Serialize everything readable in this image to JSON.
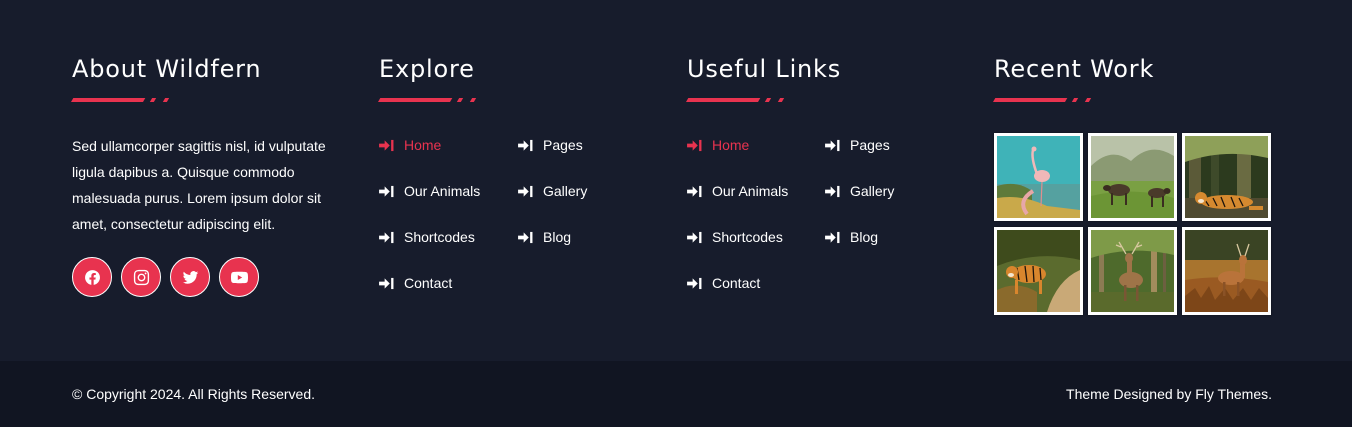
{
  "about": {
    "title": "About Wildfern",
    "text": "Sed ullamcorper sagittis nisl, id vulputate ligula dapibus a. Quisque commodo malesuada purus. Lorem ipsum dolor sit amet, consectetur adipiscing elit.",
    "socials": [
      {
        "name": "facebook-icon"
      },
      {
        "name": "instagram-icon"
      },
      {
        "name": "twitter-icon"
      },
      {
        "name": "youtube-icon"
      }
    ]
  },
  "explore": {
    "title": "Explore",
    "items": [
      "Home",
      "Pages",
      "Our Animals",
      "Gallery",
      "Shortcodes",
      "Blog",
      "Contact"
    ]
  },
  "useful": {
    "title": "Useful Links",
    "items": [
      "Home",
      "Pages",
      "Our Animals",
      "Gallery",
      "Shortcodes",
      "Blog",
      "Contact"
    ]
  },
  "recent": {
    "title": "Recent Work",
    "images": [
      "flamingo",
      "wildebeest",
      "tiger-resting",
      "tiger-walking",
      "deer-forest",
      "deer-field"
    ]
  },
  "footer": {
    "copyright": "© Copyright 2024. All Rights Reserved.",
    "credit_prefix": "Theme Designed by ",
    "credit_link": "Fly Themes",
    "credit_suffix": "."
  },
  "colors": {
    "background": "#171c2c",
    "bottom_bar": "#111522",
    "accent": "#e8334f"
  }
}
